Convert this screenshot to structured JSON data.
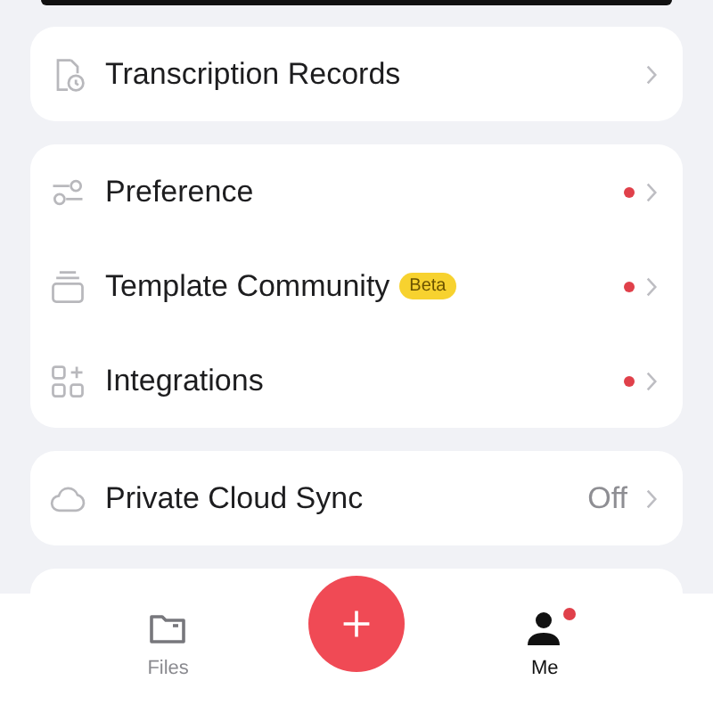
{
  "sections": [
    {
      "items": [
        {
          "kind": "records",
          "label": "Transcription Records",
          "dot": false
        }
      ]
    },
    {
      "items": [
        {
          "kind": "preference",
          "label": "Preference",
          "dot": true
        },
        {
          "kind": "template",
          "label": "Template Community",
          "badge": "Beta",
          "dot": true
        },
        {
          "kind": "integrations",
          "label": "Integrations",
          "dot": true
        }
      ]
    },
    {
      "items": [
        {
          "kind": "cloud",
          "label": "Private Cloud Sync",
          "value": "Off",
          "dot": false
        }
      ]
    }
  ],
  "tab_bar": {
    "tabs": [
      {
        "kind": "folder",
        "label": "Files",
        "selected": false,
        "dot": false
      },
      {
        "kind": "person",
        "label": "Me",
        "selected": true,
        "dot": true
      }
    ]
  }
}
